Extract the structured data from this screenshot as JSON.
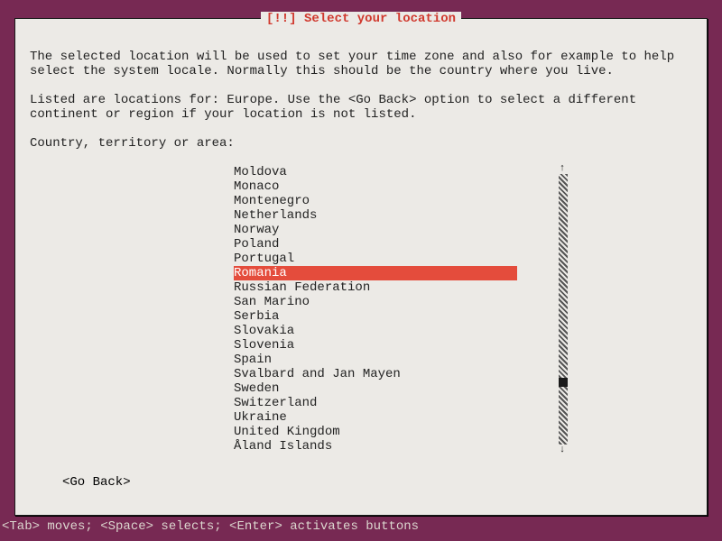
{
  "title": "[!!] Select your location",
  "para1": "The selected location will be used to set your time zone and also for example to help select the system locale. Normally this should be the country where you live.",
  "para2": "Listed are locations for: Europe. Use the <Go Back> option to select a different continent or region if your location is not listed.",
  "prompt": "Country, territory or area:",
  "countries": [
    "Moldova",
    "Monaco",
    "Montenegro",
    "Netherlands",
    "Norway",
    "Poland",
    "Portugal",
    "Romania",
    "Russian Federation",
    "San Marino",
    "Serbia",
    "Slovakia",
    "Slovenia",
    "Spain",
    "Svalbard and Jan Mayen",
    "Sweden",
    "Switzerland",
    "Ukraine",
    "United Kingdom",
    "Åland Islands"
  ],
  "selected_index": 7,
  "go_back": "<Go Back>",
  "arrows": {
    "up": "↑",
    "down": "↓"
  },
  "statusbar": "<Tab> moves; <Space> selects; <Enter> activates buttons"
}
